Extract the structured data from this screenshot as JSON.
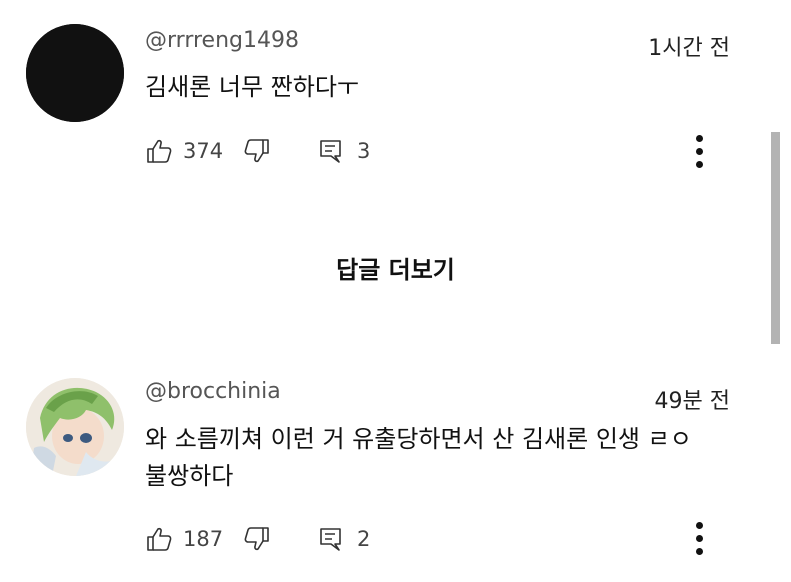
{
  "comments": [
    {
      "author": "@rrrreng1498",
      "time": "1시간 전",
      "text": "김새론 너무 짠하다ㅜ",
      "likes": "374",
      "replies": "3",
      "avatar_color": "#111111"
    },
    {
      "author": "@brocchinia",
      "time": "49분 전",
      "text": "와 소름끼쳐 이런 거 유출당하면서 산 김새론 인생 ㄹㅇ\n불쌍하다",
      "likes": "187",
      "replies": "2",
      "avatar_color": "#f1ede6"
    }
  ],
  "more_replies_label": "답글 더보기",
  "icons": {
    "like": "thumbs-up-icon",
    "dislike": "thumbs-down-icon",
    "reply": "reply-icon",
    "more": "more-vertical-icon"
  },
  "colors": {
    "text": "#0f0f0f",
    "muted": "#555555",
    "scrollbar": "#b3b3b3"
  }
}
